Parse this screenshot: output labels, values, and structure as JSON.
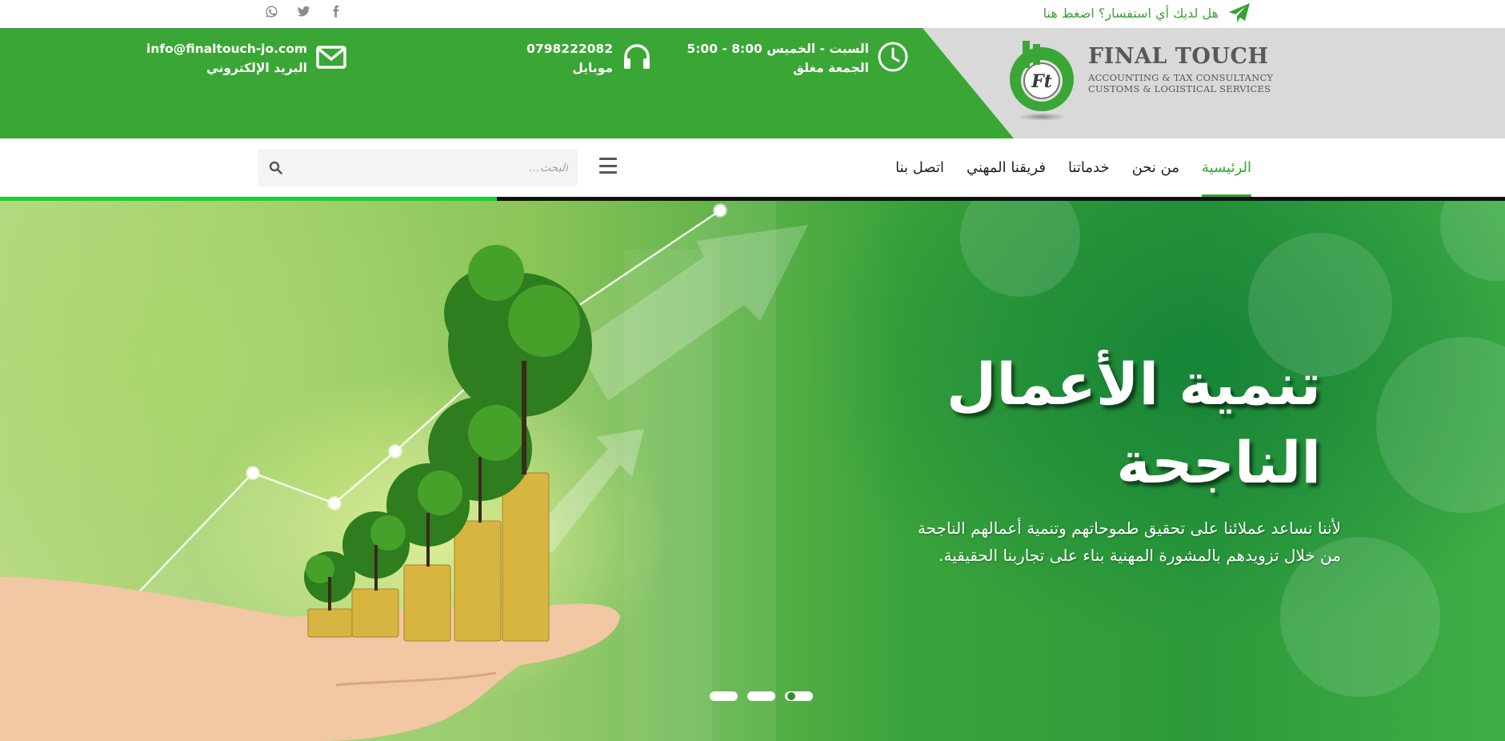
{
  "topbar": {
    "inquiry_text": "هل لديك أي استفسار؟ اضغط هنا",
    "inquiry_icon": "paper-plane-icon",
    "social": [
      "facebook-icon",
      "twitter-icon",
      "whatsapp-icon"
    ]
  },
  "header": {
    "brand_name": "FINAL TOUCH",
    "brand_line1": "ACCOUNTING & TAX CONSULTANCY",
    "brand_line2": "CUSTOMS & LOGISTICAL SERVICES",
    "logo_initials": "Ft",
    "hours": {
      "line1": "السبت - الخميس 8:00 - 5:00",
      "line2": "الجمعة مغلق",
      "icon": "clock-icon"
    },
    "phone": {
      "line1": "0798222082",
      "line2": "موبايل",
      "icon": "headphones-icon"
    },
    "email": {
      "line1": "info@finaltouch-jo.com",
      "line2": "البريد الإلكتروني",
      "icon": "envelope-icon"
    },
    "colors": {
      "green": "#3aa635",
      "grey": "#d9d9d9"
    }
  },
  "nav": {
    "items": [
      {
        "label": "الرئيسية",
        "active": true
      },
      {
        "label": "من نحن"
      },
      {
        "label": "خدماتنا"
      },
      {
        "label": "فريقنا المهني"
      },
      {
        "label": "اتصل بنا"
      }
    ],
    "search_placeholder": "البحث...",
    "progress_fraction": 0.33
  },
  "hero": {
    "headline_line1": "تنمية الأعمال",
    "headline_line2": "الناجحة",
    "sub_line1": "لأننا نساعد عملائنا على تحقيق طموحاتهم وتنمية أعمالهم الناجحة",
    "sub_line2": "من خلال تزويدهم بالمشورة المهنية بناء على تجاربنا الحقيقية.",
    "slides": 3,
    "active_slide": 3
  }
}
